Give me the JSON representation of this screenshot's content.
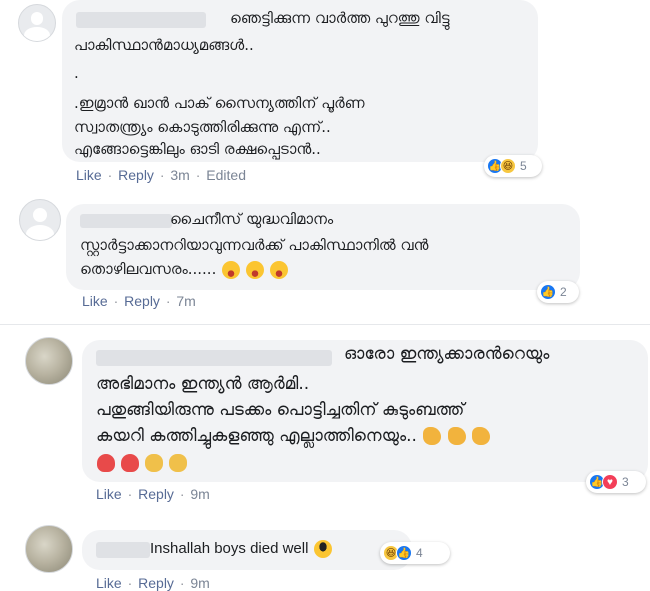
{
  "comments": [
    {
      "lines": [
        "ഞെട്ടിക്കുന്ന വാർത്ത പുറത്തു വിട്ടു",
        "പാകിസ്ഥാൻമാധ്യമങ്ങൾ..",
        ".",
        ".ഇമ്രാൻ ഖാൻ പാക് സൈന്യത്തിന് പൂർണ",
        "സ്വാതന്ത്ര്യം കൊടുത്തിരിക്കുന്നു എന്ന്..",
        "എങ്ങോട്ടെങ്കിലും ഓടി രക്ഷപ്പെടാൻ.."
      ],
      "like": "Like",
      "reply": "Reply",
      "time": "3m",
      "edited": "Edited",
      "reaction_count": "5"
    },
    {
      "lines": [
        "ചൈനീസ് യുദ്ധവിമാനം",
        "സ്റ്റാർട്ടാക്കാനറിയാവുന്നവർക്ക് പാകിസ്ഥാനിൽ വൻ",
        "തൊഴിലവസരം......"
      ],
      "like": "Like",
      "reply": "Reply",
      "time": "7m",
      "reaction_count": "2"
    },
    {
      "lines": [
        "ഓരോ ഇന്ത്യക്കാരൻറെയും",
        "അഭിമാനം ഇന്ത്യൻ ആർമി..",
        "പതുങ്ങിയിരുന്നു പടക്കം പൊട്ടിച്ചതിന് കുടുംബത്ത്",
        "കയറി കത്തിച്ചുകളഞ്ഞു എല്ലാത്തിനെയും.."
      ],
      "like": "Like",
      "reply": "Reply",
      "time": "9m",
      "reaction_count": "3"
    },
    {
      "lines": [
        "Inshallah boys died well"
      ],
      "like": "Like",
      "reply": "Reply",
      "time": "9m",
      "reaction_count": "4"
    }
  ],
  "meta_separator": "·",
  "colors": {
    "bubble": "#f2f3f5",
    "link": "#576b95",
    "like_blue": "#1877f2",
    "love_red": "#f33e58",
    "haha_yellow": "#f7c740"
  },
  "icons": {
    "like": "thumbs-up-icon",
    "haha": "laughing-face-icon",
    "love": "heart-icon"
  }
}
